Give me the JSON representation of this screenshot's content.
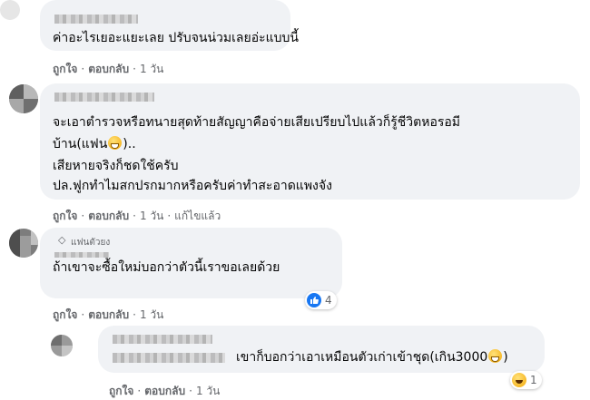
{
  "comments": [
    {
      "text_lines": [
        "ค่าอะไรเยอะแยะเลย ปรับจนน่วมเลยอ่ะแบบนี้"
      ],
      "actions": {
        "like": "ถูกใจ",
        "reply": "ตอบกลับ",
        "time": "1 วัน"
      }
    },
    {
      "text_lines": [
        "จะเอาตำรวจหรือทนายสุดท้ายสัญญาคือจ่ายเสียเปรียบไปแล้วก็รู้ชีวิตหอรอมี",
        "บ้าน(แฟน",
        ")..",
        "เสียหายจริงก็ชดใช้ครับ",
        "ปล.ฟูกทำไมสกปรกมากหรือครับค่าทำสะอาดแพงจัง"
      ],
      "actions": {
        "like": "ถูกใจ",
        "reply": "ตอบกลับ",
        "time": "1 วัน",
        "edited": "แก้ไขแล้ว"
      }
    },
    {
      "badge": "แฟนตัวยง",
      "text_lines": [
        "ถ้าเขาจะซื้อใหม่บอกว่าตัวนี้เราขอเลยด้วย"
      ],
      "reaction": {
        "icon": "like-icon",
        "count": "4"
      },
      "actions": {
        "like": "ถูกใจ",
        "reply": "ตอบกลับ",
        "time": "1 วัน"
      }
    },
    {
      "text_lines": [
        "เขาก็บอกว่าเอาเหมือนตัวเก่าเข้าชุด(เกิน3000",
        ")"
      ],
      "reaction": {
        "icon": "haha-icon",
        "count": "1"
      },
      "actions": {
        "like": "ถูกใจ",
        "reply": "ตอบกลับ",
        "time": "1 วัน"
      }
    }
  ],
  "colors": {
    "bubble": "#f0f2f5",
    "secondary_text": "#65676b",
    "like_blue": "#1877f2"
  }
}
